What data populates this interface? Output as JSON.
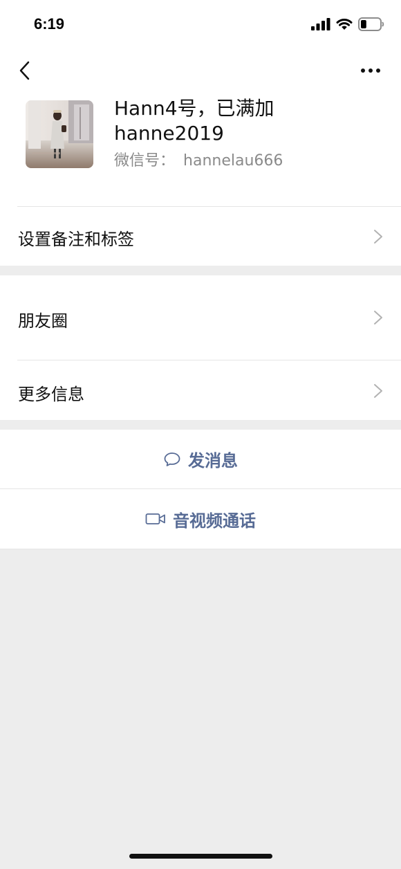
{
  "status_bar": {
    "time": "6:19",
    "icons": [
      "signal-icon",
      "wifi-icon",
      "battery-icon"
    ],
    "battery_level": 0.3
  },
  "nav": {
    "back_icon": "chevron-left-icon",
    "more_icon": "more-dots-icon"
  },
  "profile": {
    "name_line1": "Hann4号，已满加",
    "name_line2": "hanne2019",
    "wechat_id_label": "微信号：",
    "wechat_id": "hannelau666"
  },
  "menu": {
    "remark_tags": "设置备注和标签",
    "moments": "朋友圈",
    "more_info": "更多信息"
  },
  "actions": {
    "send_message": "发消息",
    "av_call": "音视频通话"
  },
  "colors": {
    "page_bg": "#ededed",
    "card_bg": "#ffffff",
    "link": "#576b95",
    "secondary_text": "#8a8a8a"
  }
}
